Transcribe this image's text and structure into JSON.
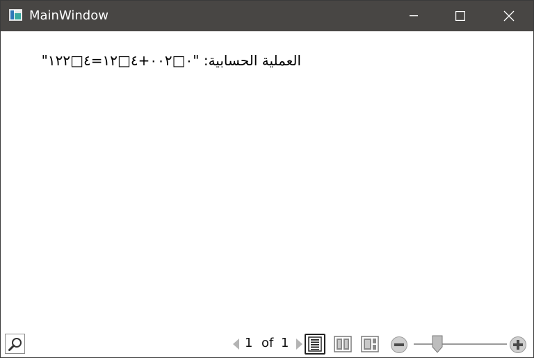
{
  "window": {
    "title": "MainWindow",
    "icon": "app-window-icon",
    "caption_buttons": [
      "minimize-icon",
      "maximize-icon",
      "close-icon"
    ]
  },
  "content": {
    "text": "العملية الحسابية: \"٠□٠٠٢+٤□١٢=٤□١٢٢\""
  },
  "viewer": {
    "page_current": "1",
    "page_of": "of",
    "page_total": "1",
    "view_modes": [
      "single-page-icon",
      "two-page-icon",
      "side-by-side-icon"
    ],
    "zoom_fraction": 0.25
  },
  "colors": {
    "titlebar_bg": "#484644",
    "titlebar_fg": "#ffffff",
    "content_bg": "#ffffff",
    "text": "#000000"
  }
}
